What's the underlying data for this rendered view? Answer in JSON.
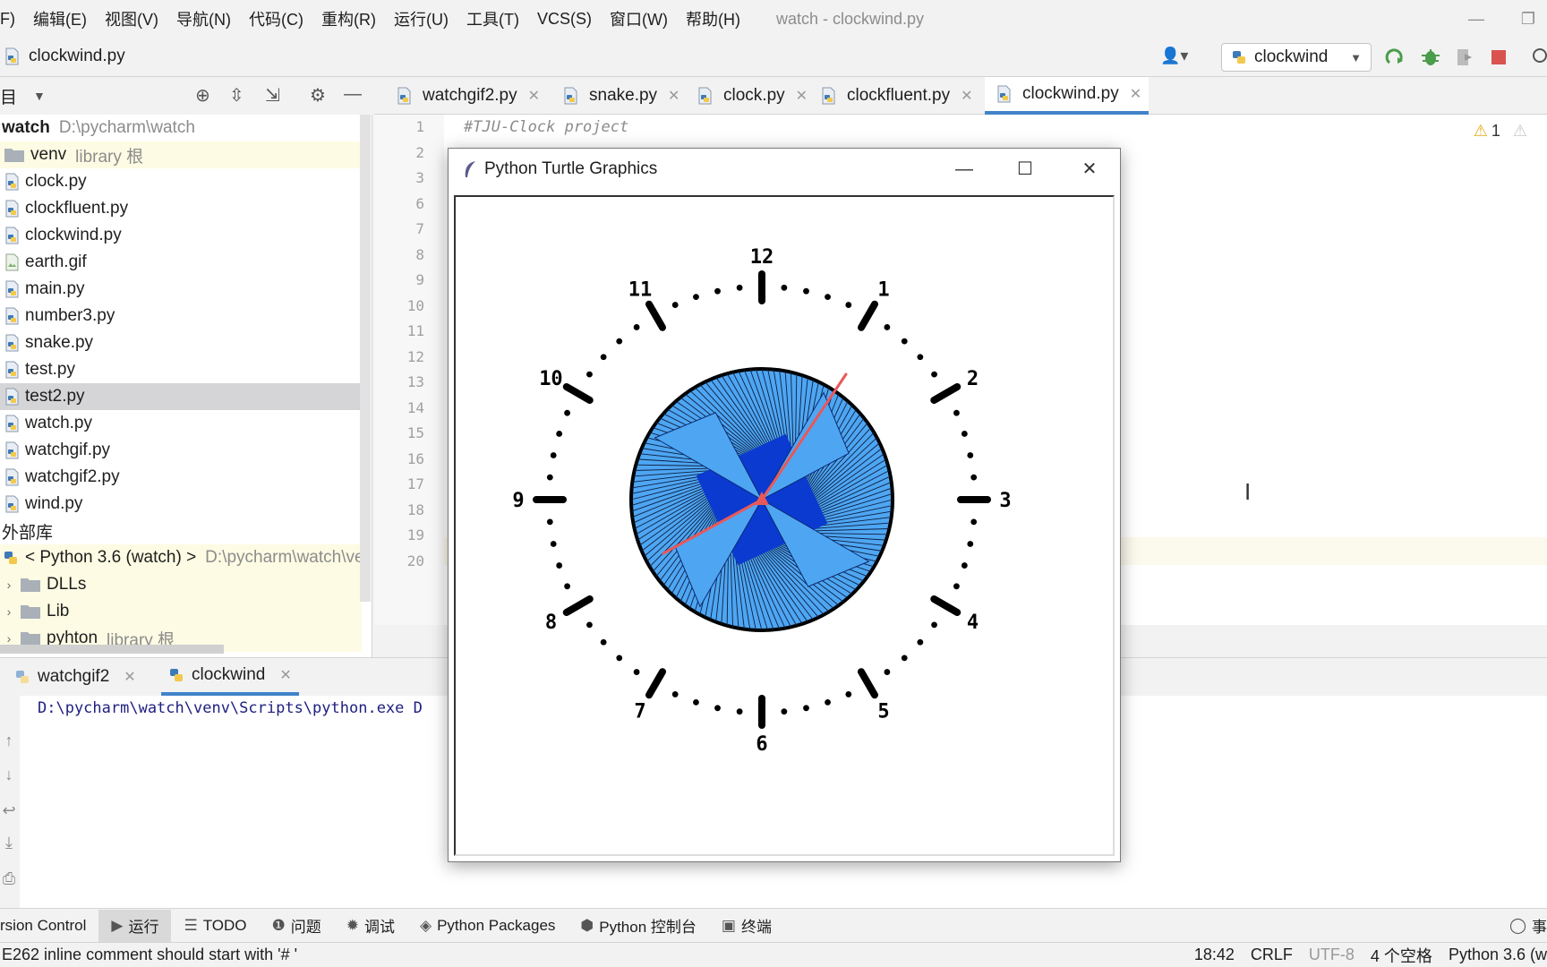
{
  "menu": {
    "items": [
      "F)",
      "编辑(E)",
      "视图(V)",
      "导航(N)",
      "代码(C)",
      "重构(R)",
      "运行(U)",
      "工具(T)",
      "VCS(S)",
      "窗口(W)",
      "帮助(H)"
    ],
    "app_title": "watch - clockwind.py"
  },
  "navbar": {
    "current_file": "clockwind.py",
    "run_config": "clockwind"
  },
  "project": {
    "header_label": "目",
    "root_name": "watch",
    "root_path": "D:\\pycharm\\watch",
    "venv_name": "venv",
    "venv_tag": "library 根",
    "files": [
      "clock.py",
      "clockfluent.py",
      "clockwind.py",
      "earth.gif",
      "main.py",
      "number3.py",
      "snake.py",
      "test.py",
      "test2.py",
      "watch.py",
      "watchgif.py",
      "watchgif2.py",
      "wind.py"
    ],
    "external_libs": "外部库",
    "sdk_name": "< Python 3.6 (watch) >",
    "sdk_path": "D:\\pycharm\\watch\\ve",
    "sdk_children": [
      "DLLs",
      "Lib",
      "pyhton"
    ],
    "pyhton_tag": "library 根"
  },
  "editor": {
    "tabs": [
      "watchgif2.py",
      "snake.py",
      "clock.py",
      "clockfluent.py",
      "clockwind.py"
    ],
    "active_tab": "clockwind.py",
    "line_numbers": [
      "1",
      "2",
      "3",
      "6",
      "7",
      "8",
      "9",
      "10",
      "11",
      "12",
      "13",
      "14",
      "15",
      "16",
      "17",
      "18",
      "19",
      "20"
    ],
    "first_line": "#TJU-Clock project",
    "warning_count": "1"
  },
  "run_panel": {
    "tabs": [
      "watchgif2",
      "clockwind"
    ],
    "active_tab": "clockwind",
    "console_text": "D:\\pycharm\\watch\\venv\\Scripts\\python.exe D"
  },
  "tool_windows": [
    "rsion Control",
    "运行",
    "TODO",
    "问题",
    "调试",
    "Python Packages",
    "Python 控制台",
    "终端",
    "事"
  ],
  "status": {
    "message": "E262 inline comment should start with '# '",
    "position": "18:42",
    "line_sep": "CRLF",
    "encoding": "UTF-8",
    "indent": "4 个空格",
    "interpreter": "Python 3.6 (w"
  },
  "turtle": {
    "title": "Python Turtle Graphics",
    "clock_numbers": [
      "12",
      "1",
      "2",
      "3",
      "4",
      "5",
      "6",
      "7",
      "8",
      "9",
      "10",
      "11"
    ],
    "hand_color": "#e8585a",
    "blade_color": "#4ea6f2",
    "dark_blue": "#0b3ad1"
  },
  "colors": {
    "accent": "#4083c9",
    "selected_row": "#d5d5d8",
    "library_highlight": "#fdfbe3"
  }
}
